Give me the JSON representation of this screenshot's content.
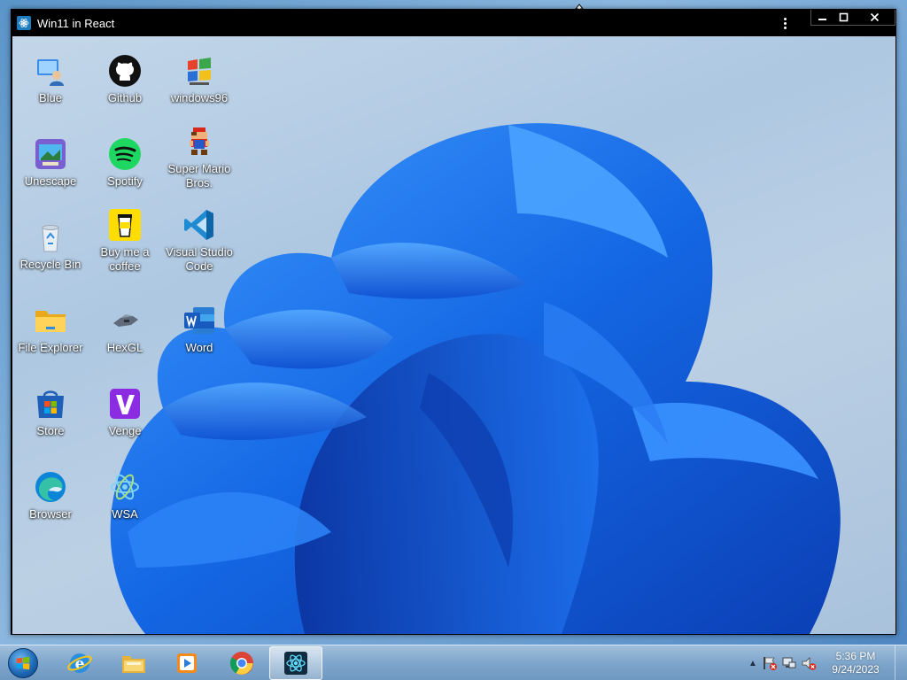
{
  "window": {
    "title": "Win11 in React"
  },
  "desktop_icons": [
    {
      "label": "Blue",
      "icon": "blue-user-icon"
    },
    {
      "label": "Github",
      "icon": "github-icon"
    },
    {
      "label": "windows96",
      "icon": "windows96-icon"
    },
    {
      "label": "Unescape",
      "icon": "unescape-icon"
    },
    {
      "label": "Spotify",
      "icon": "spotify-icon"
    },
    {
      "label": "Super Mario Bros.",
      "icon": "mario-icon"
    },
    {
      "label": "Recycle Bin",
      "icon": "recycle-bin-icon"
    },
    {
      "label": "Buy me a coffee",
      "icon": "coffee-icon"
    },
    {
      "label": "Visual Studio Code",
      "icon": "vscode-icon"
    },
    {
      "label": "File Explorer",
      "icon": "folder-icon"
    },
    {
      "label": "HexGL",
      "icon": "hexgl-icon"
    },
    {
      "label": "Word",
      "icon": "word-icon"
    },
    {
      "label": "Store",
      "icon": "store-icon"
    },
    {
      "label": "Venge",
      "icon": "venge-icon"
    },
    {
      "label": "Browser",
      "icon": "edge-icon"
    },
    {
      "label": "WSA",
      "icon": "wsa-icon"
    }
  ],
  "taskbar": {
    "pinned": [
      "internet-explorer-icon",
      "windows-explorer-icon",
      "media-player-icon",
      "chrome-icon",
      "react-app-icon"
    ],
    "clock": {
      "time": "5:36 PM",
      "date": "9/24/2023"
    }
  },
  "colors": {
    "titlebar": "#000000",
    "bloom_blue": "#1a6ee8",
    "taskbar": "#7fa6cb"
  }
}
